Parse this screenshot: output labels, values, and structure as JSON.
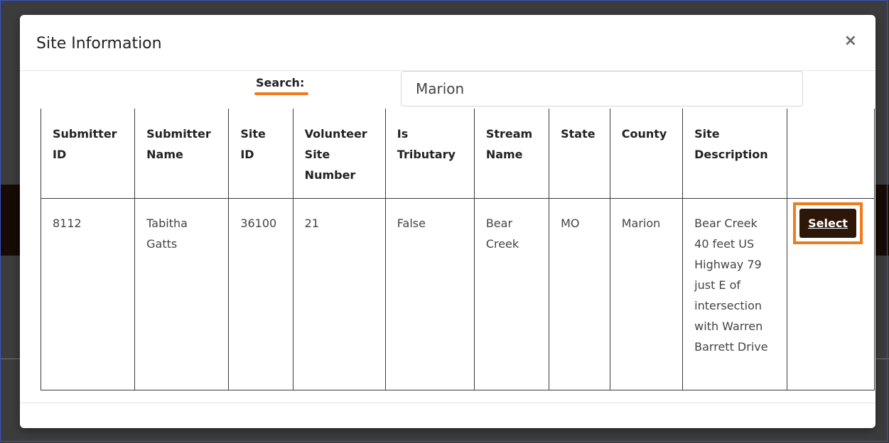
{
  "modal": {
    "title": "Site Information",
    "close_label": "×"
  },
  "search": {
    "label": "Search:",
    "value": "Marion"
  },
  "table": {
    "headers": [
      "Submitter ID",
      "Submitter Name",
      "Site ID",
      "Volunteer Site Number",
      "Is Tributary",
      "Stream Name",
      "State",
      "County",
      "Site Description",
      ""
    ],
    "rows": [
      {
        "submitter_id": "8112",
        "submitter_name": "Tabitha Gatts",
        "site_id": "36100",
        "volunteer_site_number": "21",
        "is_tributary": "False",
        "stream_name": "Bear Creek",
        "state": "MO",
        "county": "Marion",
        "site_description": "Bear Creek 40 feet US Highway 79 just E of intersection with Warren Barrett Drive",
        "action_label": "Select"
      }
    ]
  },
  "colors": {
    "highlight": "#f07b1d",
    "select_button": "#2d1708",
    "background_text": "#b00000"
  }
}
